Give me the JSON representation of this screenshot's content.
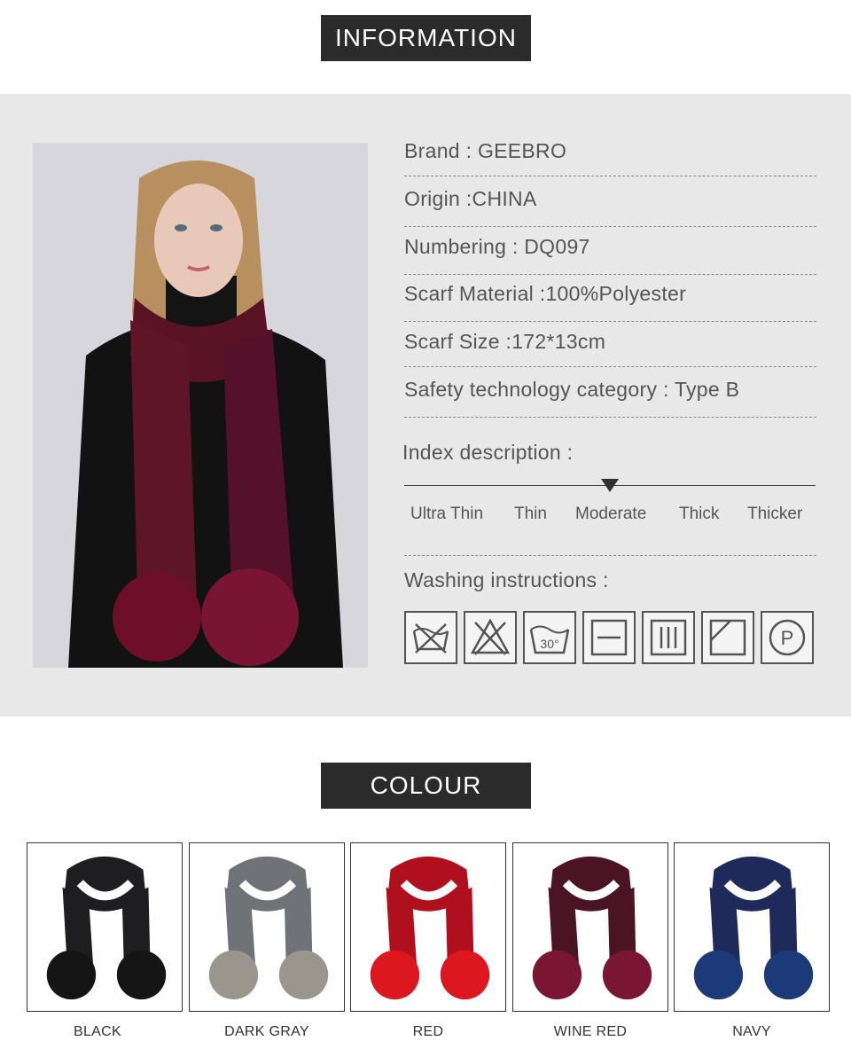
{
  "information": {
    "title": "INFORMATION",
    "specs": [
      "Brand : GEEBRO",
      "Origin :CHINA",
      "Numbering : DQ097",
      "Scarf Material :100%Polyester",
      "Scarf Size :172*13cm",
      "Safety technology category : Type B"
    ],
    "index_heading": "Index description :",
    "index_scale": [
      "Ultra Thin",
      "Thin",
      "Moderate",
      "Thick",
      "Thicker"
    ],
    "index_selected": "Moderate",
    "washing_heading": "Washing instructions :",
    "washing_icons": [
      {
        "icon": "do-not-wash-icon"
      },
      {
        "icon": "do-not-bleach-icon"
      },
      {
        "icon": "wash-30-icon",
        "label": "30°"
      },
      {
        "icon": "dry-flat-icon"
      },
      {
        "icon": "drip-dry-icon"
      },
      {
        "icon": "dry-in-shade-icon"
      },
      {
        "icon": "professional-dry-clean-icon",
        "label": "P"
      }
    ]
  },
  "colour": {
    "title": "COLOUR",
    "options": [
      {
        "name": "BLACK",
        "scarf": "#1e1e20",
        "pom": "#151515"
      },
      {
        "name": "DARK GRAY",
        "scarf": "#6f7378",
        "pom": "#9a958d"
      },
      {
        "name": "RED",
        "scarf": "#b0101e",
        "pom": "#dc1720"
      },
      {
        "name": "WINE RED",
        "scarf": "#4b1424",
        "pom": "#7a1533"
      },
      {
        "name": "NAVY",
        "scarf": "#1d2a5a",
        "pom": "#1c3a78"
      }
    ]
  }
}
